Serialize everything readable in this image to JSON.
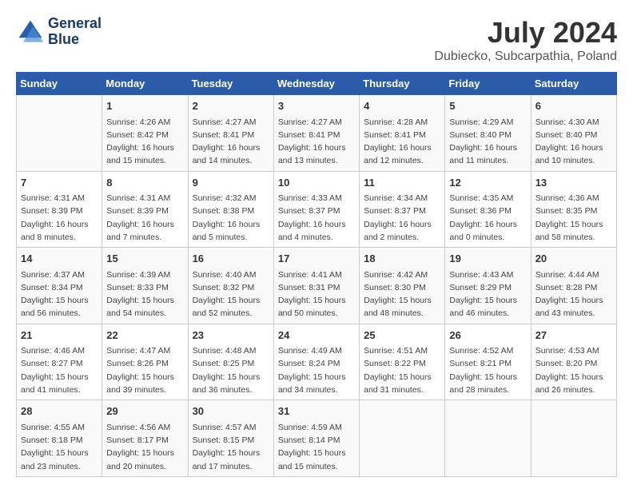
{
  "header": {
    "logo_line1": "General",
    "logo_line2": "Blue",
    "title": "July 2024",
    "subtitle": "Dubiecko, Subcarpathia, Poland"
  },
  "days_of_week": [
    "Sunday",
    "Monday",
    "Tuesday",
    "Wednesday",
    "Thursday",
    "Friday",
    "Saturday"
  ],
  "weeks": [
    [
      {
        "day": "",
        "info": ""
      },
      {
        "day": "1",
        "info": "Sunrise: 4:26 AM\nSunset: 8:42 PM\nDaylight: 16 hours\nand 15 minutes."
      },
      {
        "day": "2",
        "info": "Sunrise: 4:27 AM\nSunset: 8:41 PM\nDaylight: 16 hours\nand 14 minutes."
      },
      {
        "day": "3",
        "info": "Sunrise: 4:27 AM\nSunset: 8:41 PM\nDaylight: 16 hours\nand 13 minutes."
      },
      {
        "day": "4",
        "info": "Sunrise: 4:28 AM\nSunset: 8:41 PM\nDaylight: 16 hours\nand 12 minutes."
      },
      {
        "day": "5",
        "info": "Sunrise: 4:29 AM\nSunset: 8:40 PM\nDaylight: 16 hours\nand 11 minutes."
      },
      {
        "day": "6",
        "info": "Sunrise: 4:30 AM\nSunset: 8:40 PM\nDaylight: 16 hours\nand 10 minutes."
      }
    ],
    [
      {
        "day": "7",
        "info": "Sunrise: 4:31 AM\nSunset: 8:39 PM\nDaylight: 16 hours\nand 8 minutes."
      },
      {
        "day": "8",
        "info": "Sunrise: 4:31 AM\nSunset: 8:39 PM\nDaylight: 16 hours\nand 7 minutes."
      },
      {
        "day": "9",
        "info": "Sunrise: 4:32 AM\nSunset: 8:38 PM\nDaylight: 16 hours\nand 5 minutes."
      },
      {
        "day": "10",
        "info": "Sunrise: 4:33 AM\nSunset: 8:37 PM\nDaylight: 16 hours\nand 4 minutes."
      },
      {
        "day": "11",
        "info": "Sunrise: 4:34 AM\nSunset: 8:37 PM\nDaylight: 16 hours\nand 2 minutes."
      },
      {
        "day": "12",
        "info": "Sunrise: 4:35 AM\nSunset: 8:36 PM\nDaylight: 16 hours\nand 0 minutes."
      },
      {
        "day": "13",
        "info": "Sunrise: 4:36 AM\nSunset: 8:35 PM\nDaylight: 15 hours\nand 58 minutes."
      }
    ],
    [
      {
        "day": "14",
        "info": "Sunrise: 4:37 AM\nSunset: 8:34 PM\nDaylight: 15 hours\nand 56 minutes."
      },
      {
        "day": "15",
        "info": "Sunrise: 4:39 AM\nSunset: 8:33 PM\nDaylight: 15 hours\nand 54 minutes."
      },
      {
        "day": "16",
        "info": "Sunrise: 4:40 AM\nSunset: 8:32 PM\nDaylight: 15 hours\nand 52 minutes."
      },
      {
        "day": "17",
        "info": "Sunrise: 4:41 AM\nSunset: 8:31 PM\nDaylight: 15 hours\nand 50 minutes."
      },
      {
        "day": "18",
        "info": "Sunrise: 4:42 AM\nSunset: 8:30 PM\nDaylight: 15 hours\nand 48 minutes."
      },
      {
        "day": "19",
        "info": "Sunrise: 4:43 AM\nSunset: 8:29 PM\nDaylight: 15 hours\nand 46 minutes."
      },
      {
        "day": "20",
        "info": "Sunrise: 4:44 AM\nSunset: 8:28 PM\nDaylight: 15 hours\nand 43 minutes."
      }
    ],
    [
      {
        "day": "21",
        "info": "Sunrise: 4:46 AM\nSunset: 8:27 PM\nDaylight: 15 hours\nand 41 minutes."
      },
      {
        "day": "22",
        "info": "Sunrise: 4:47 AM\nSunset: 8:26 PM\nDaylight: 15 hours\nand 39 minutes."
      },
      {
        "day": "23",
        "info": "Sunrise: 4:48 AM\nSunset: 8:25 PM\nDaylight: 15 hours\nand 36 minutes."
      },
      {
        "day": "24",
        "info": "Sunrise: 4:49 AM\nSunset: 8:24 PM\nDaylight: 15 hours\nand 34 minutes."
      },
      {
        "day": "25",
        "info": "Sunrise: 4:51 AM\nSunset: 8:22 PM\nDaylight: 15 hours\nand 31 minutes."
      },
      {
        "day": "26",
        "info": "Sunrise: 4:52 AM\nSunset: 8:21 PM\nDaylight: 15 hours\nand 28 minutes."
      },
      {
        "day": "27",
        "info": "Sunrise: 4:53 AM\nSunset: 8:20 PM\nDaylight: 15 hours\nand 26 minutes."
      }
    ],
    [
      {
        "day": "28",
        "info": "Sunrise: 4:55 AM\nSunset: 8:18 PM\nDaylight: 15 hours\nand 23 minutes."
      },
      {
        "day": "29",
        "info": "Sunrise: 4:56 AM\nSunset: 8:17 PM\nDaylight: 15 hours\nand 20 minutes."
      },
      {
        "day": "30",
        "info": "Sunrise: 4:57 AM\nSunset: 8:15 PM\nDaylight: 15 hours\nand 17 minutes."
      },
      {
        "day": "31",
        "info": "Sunrise: 4:59 AM\nSunset: 8:14 PM\nDaylight: 15 hours\nand 15 minutes."
      },
      {
        "day": "",
        "info": ""
      },
      {
        "day": "",
        "info": ""
      },
      {
        "day": "",
        "info": ""
      }
    ]
  ]
}
